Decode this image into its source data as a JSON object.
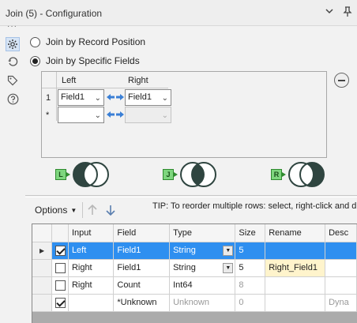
{
  "window": {
    "title": "Join (5) - Configuration",
    "icons": [
      "chevron-down-icon",
      "pin-icon"
    ]
  },
  "side_toolbar": {
    "items": [
      {
        "name": "configuration-gear-icon",
        "active": true
      },
      {
        "name": "connection-icon",
        "active": false
      },
      {
        "name": "annotation-tag-icon",
        "active": false
      },
      {
        "name": "help-icon",
        "active": false
      }
    ]
  },
  "join_mode": {
    "options": [
      {
        "label": "Join by Record Position",
        "selected": false
      },
      {
        "label": "Join by Specific Fields",
        "selected": true
      }
    ]
  },
  "fields_grid": {
    "left_header": "Left",
    "right_header": "Right",
    "rows": [
      {
        "num": "1",
        "left": "Field1",
        "right": "Field1"
      },
      {
        "num": "*",
        "left": "",
        "right": ""
      }
    ]
  },
  "venn": [
    {
      "tag": "L",
      "output": "left"
    },
    {
      "tag": "J",
      "output": "join"
    },
    {
      "tag": "R",
      "output": "right"
    }
  ],
  "toolbar": {
    "options_label": "Options",
    "tip": "TIP: To reorder multiple rows: select, right-click and dr"
  },
  "table": {
    "columns": [
      "",
      "",
      "Input",
      "Field",
      "Type",
      "Size",
      "Rename",
      "Desc"
    ],
    "rows": [
      {
        "selected": true,
        "checked": true,
        "input": "Left",
        "field": "Field1",
        "type": "String",
        "size": "5",
        "rename": "",
        "desc": "",
        "muted": false
      },
      {
        "selected": false,
        "checked": false,
        "input": "Right",
        "field": "Field1",
        "type": "String",
        "size": "5",
        "rename": "Right_Field1",
        "desc": "",
        "muted": false
      },
      {
        "selected": false,
        "checked": false,
        "input": "Right",
        "field": "Count",
        "type": "Int64",
        "size": "8",
        "rename": "",
        "desc": "",
        "muted": false
      },
      {
        "selected": false,
        "checked": true,
        "input": "",
        "field": "*Unknown",
        "type": "Unknown",
        "size": "0",
        "rename": "",
        "desc": "Dyna",
        "muted": true
      }
    ]
  }
}
